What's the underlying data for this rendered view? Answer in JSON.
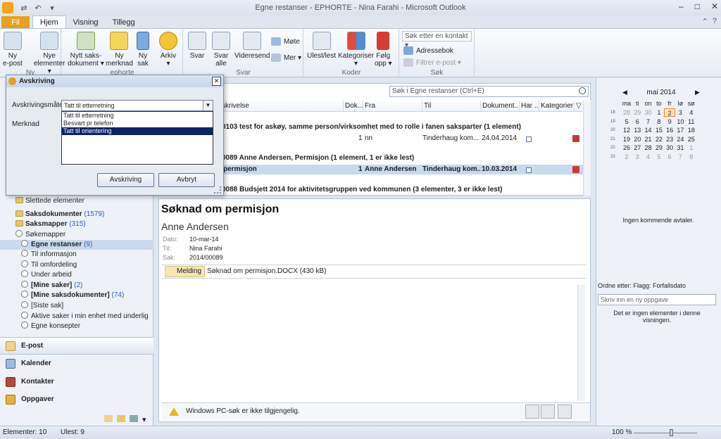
{
  "window": {
    "title": "Egne restanser - EPHORTE - Nina Farahi - Microsoft Outlook",
    "controls": [
      "–",
      "□",
      "✕"
    ]
  },
  "ribbon": {
    "tabs": [
      "Fil",
      "Hjem",
      "Visning",
      "Tillegg"
    ],
    "groups": {
      "ny": {
        "label": "Ny",
        "new_email": [
          "Ny",
          "e-post"
        ],
        "new_items": [
          "Nye",
          "elementer ▾"
        ]
      },
      "ephorte": {
        "label": "ephorte",
        "new_case_doc": [
          "Nytt saks-",
          "dokument ▾"
        ],
        "new_note": [
          "Ny",
          "merknad"
        ],
        "new_case": [
          "Ny",
          "sak"
        ],
        "archive": [
          "Arkiv",
          "▾"
        ]
      },
      "svar": {
        "label": "Svar",
        "reply": [
          "Svar"
        ],
        "reply_all": [
          "Svar",
          "alle"
        ],
        "forward": [
          "Videresend"
        ],
        "meeting": "Møte",
        "more": "Mer ▾"
      },
      "koder": {
        "label": "Koder",
        "unread_read": [
          "Ulest/lest"
        ],
        "categorize": [
          "Kategoriser",
          "▾"
        ],
        "follow_up": [
          "Følg",
          "opp ▾"
        ]
      },
      "sok": {
        "label": "Søk",
        "search_contact": "Søk etter en kontakt ▾",
        "address_book": "Adressebok",
        "filter_email": "Filtrer e-post ▾"
      }
    }
  },
  "dialog": {
    "title": "Avskriving",
    "method_label": "Avskrivingsmåte",
    "note_label": "Merknad",
    "selected_value": "Tatt til etterretning",
    "options": [
      "Tatt til etterretning",
      "Besvart pr telefon",
      "Tatt til orientering"
    ],
    "highlighted_option": "Tatt til orientering",
    "ok_button": "Avskriving",
    "cancel_button": "Avbryt"
  },
  "folders": [
    {
      "name": "Slettede elementer",
      "count": "",
      "bold": false
    },
    {
      "name": "Saksdokumenter",
      "count": "(1579)",
      "bold": true
    },
    {
      "name": "Saksmapper",
      "count": "(315)",
      "bold": true
    },
    {
      "name": "Søkemapper",
      "count": "",
      "bold": false
    },
    {
      "name": "Egne restanser",
      "count": "(9)",
      "bold": true,
      "selected": true
    },
    {
      "name": "Til informasjon",
      "count": "",
      "bold": false
    },
    {
      "name": "Til omfordeling",
      "count": "",
      "bold": false
    },
    {
      "name": "Under arbeid",
      "count": "",
      "bold": false
    },
    {
      "name": "[Mine saker]",
      "count": "(2)",
      "bold": true
    },
    {
      "name": "[Mine saksdokumenter]",
      "count": "(74)",
      "bold": true
    },
    {
      "name": "[Siste sak]",
      "count": "",
      "bold": false
    },
    {
      "name": "Aktive saker i min enhet med underlig",
      "count": "",
      "bold": false
    },
    {
      "name": "Egne konsepter",
      "count": "",
      "bold": false
    }
  ],
  "nav_buttons": [
    "E-post",
    "Kalender",
    "Kontakter",
    "Oppgaver"
  ],
  "list": {
    "search_placeholder": "Søk i  Egne restanser (Ctrl+E)",
    "columns": [
      "skrivelse",
      "Dok...",
      "Fra",
      "Til",
      "Dokument...",
      "Har ...",
      "Kategorier"
    ],
    "rows": [
      {
        "type": "group",
        "text": "0103 test for askøy, samme person/virksomhet med to rolle i fanen saksparter (1 element)"
      },
      {
        "type": "item",
        "subject": "",
        "doc": "1",
        "from": "nn",
        "to": "Tinderhaug kom...",
        "date": "24.04.2014"
      },
      {
        "type": "group",
        "text": "0089 Anne Andersen, Permisjon (1 element, 1 er ikke lest)"
      },
      {
        "type": "item",
        "subject": "permisjon",
        "doc": "1",
        "from": "Anne Andersen",
        "to": "Tinderhaug kom...",
        "date": "10.03.2014",
        "selected": true
      },
      {
        "type": "group",
        "text": "0088 Budsjett 2014 for aktivitetsgruppen ved kommunen (3 elementer, 3 er ikke lest)"
      }
    ]
  },
  "reading": {
    "subject": "Søknad om permisjon",
    "sender": "Anne Andersen",
    "date_label": "Dato:",
    "date_value": "10-mar-14",
    "to_label": "Til:",
    "to_value": "Nina Farahi",
    "case_label": "Sak:",
    "case_value": "2014/00089",
    "message_tab": "Melding",
    "attachment": "Søknad om permisjon.DOCX (430 kB)",
    "info_text": "Windows PC-søk er ikke tilgjengelig."
  },
  "calendar": {
    "month": "mai 2014",
    "weekdays": [
      "ma",
      "ti",
      "on",
      "to",
      "fr",
      "lø",
      "sø"
    ],
    "weeks": [
      {
        "wk": "18",
        "days": [
          "28",
          "29",
          "30",
          "1",
          "2",
          "3",
          "4"
        ]
      },
      {
        "wk": "19",
        "days": [
          "5",
          "6",
          "7",
          "8",
          "9",
          "10",
          "11"
        ]
      },
      {
        "wk": "20",
        "days": [
          "12",
          "13",
          "14",
          "15",
          "16",
          "17",
          "18"
        ]
      },
      {
        "wk": "21",
        "days": [
          "19",
          "20",
          "21",
          "22",
          "23",
          "24",
          "25"
        ]
      },
      {
        "wk": "22",
        "days": [
          "26",
          "27",
          "28",
          "29",
          "30",
          "31",
          "1"
        ]
      },
      {
        "wk": "23",
        "days": [
          "2",
          "3",
          "4",
          "5",
          "6",
          "7",
          "8"
        ]
      }
    ],
    "today": "2",
    "no_appointments": "Ingen kommende avtaler."
  },
  "tasks": {
    "sort_label": "Ordne etter: Flagg: Forfallsdato",
    "input_placeholder": "Skriv inn en ny oppgave",
    "empty_text": "Det er ingen elementer i denne visningen."
  },
  "status": {
    "items": "Elementer: 10",
    "unread": "Ulest: 9",
    "zoom": "100 %"
  },
  "colors": {
    "accent": "#e8a11c",
    "selection": "#c9d9ee",
    "dialog_highlight": "#0a246a"
  }
}
